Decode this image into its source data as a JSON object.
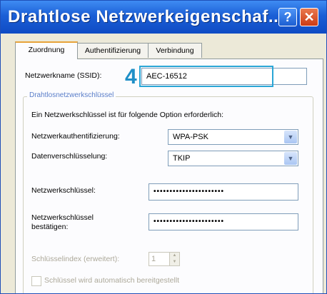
{
  "window": {
    "title": "Drahtlose Netzwerkeigenschaf...",
    "help_button": "?",
    "close_button": "✕"
  },
  "tabs": [
    {
      "label": "Zuordnung",
      "active": true
    },
    {
      "label": "Authentifizierung",
      "active": false
    },
    {
      "label": "Verbindung",
      "active": false
    }
  ],
  "ssid": {
    "label": "Netzwerkname (SSID):",
    "value": "AEC-16512",
    "step_number": "4"
  },
  "group": {
    "legend": "Drahtlosnetzwerkschlüssel",
    "info": "Ein Netzwerkschlüssel ist für folgende Option erforderlich:",
    "auth_label": "Netzwerkauthentifizierung:",
    "auth_value": "WPA-PSK",
    "enc_label": "Datenverschlüsselung:",
    "enc_value": "TKIP"
  },
  "key": {
    "label": "Netzwerkschlüssel:",
    "value": "••••••••••••••••••••••",
    "confirm_label_1": "Netzwerkschlüssel",
    "confirm_label_2": "bestätigen:",
    "confirm_value": "••••••••••••••••••••••"
  },
  "key_index": {
    "label": "Schlüsselindex (erweitert):",
    "value": "1"
  },
  "auto_key": {
    "label": "Schlüssel wird automatisch bereitgestellt"
  },
  "colors": {
    "titlebar": "#0f4bc4",
    "highlight": "#2aa6d6",
    "step_number": "#1f8fc7",
    "close": "#cc3b15"
  }
}
